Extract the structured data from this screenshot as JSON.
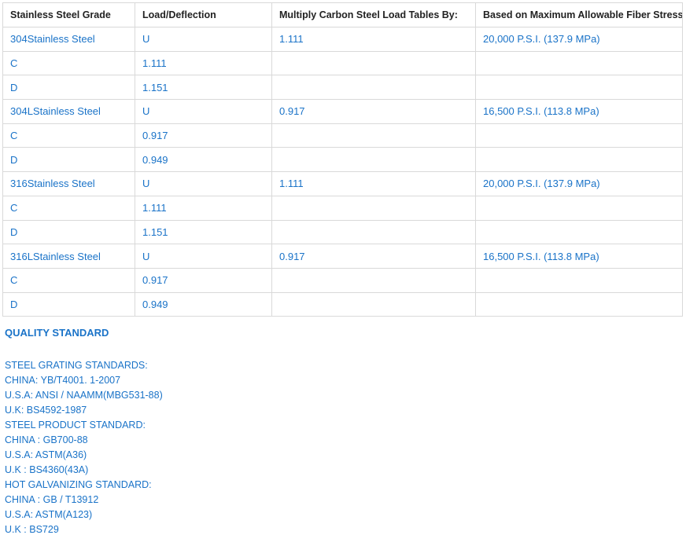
{
  "table": {
    "headers": [
      "Stainless Steel Grade",
      "Load/Deflection",
      "Multiply Carbon Steel Load Tables By:",
      "Based on Maximum Allowable Fiber Stress"
    ],
    "rows": [
      [
        "304Stainless Steel",
        "U",
        "1.111",
        "20,000 P.S.I. (137.9 MPa)"
      ],
      [
        "C",
        "1.111",
        "",
        ""
      ],
      [
        "D",
        "1.151",
        "",
        ""
      ],
      [
        "304LStainless Steel",
        "U",
        "0.917",
        "16,500 P.S.I. (113.8 MPa)"
      ],
      [
        "C",
        "0.917",
        "",
        ""
      ],
      [
        "D",
        "0.949",
        "",
        ""
      ],
      [
        "316Stainless Steel",
        "U",
        "1.111",
        "20,000 P.S.I. (137.9 MPa)"
      ],
      [
        "C",
        "1.111",
        "",
        ""
      ],
      [
        "D",
        "1.151",
        "",
        ""
      ],
      [
        "316LStainless Steel",
        "U",
        "0.917",
        "16,500 P.S.I. (113.8 MPa)"
      ],
      [
        "C",
        "0.917",
        "",
        ""
      ],
      [
        "D",
        "0.949",
        "",
        ""
      ]
    ]
  },
  "quality": {
    "title": "QUALITY STANDARD",
    "lines": [
      "STEEL GRATING STANDARDS:",
      "CHINA: YB/T4001. 1-2007",
      "U.S.A: ANSI / NAAMM(MBG531-88)",
      "U.K: BS4592-1987",
      "STEEL PRODUCT STANDARD:",
      "CHINA : GB700-88",
      "U.S.A: ASTM(A36)",
      "U.K : BS4360(43A)",
      "HOT GALVANIZING STANDARD:",
      "CHINA : GB / T13912",
      "U.S.A: ASTM(A123)",
      "U.K : BS729"
    ]
  }
}
